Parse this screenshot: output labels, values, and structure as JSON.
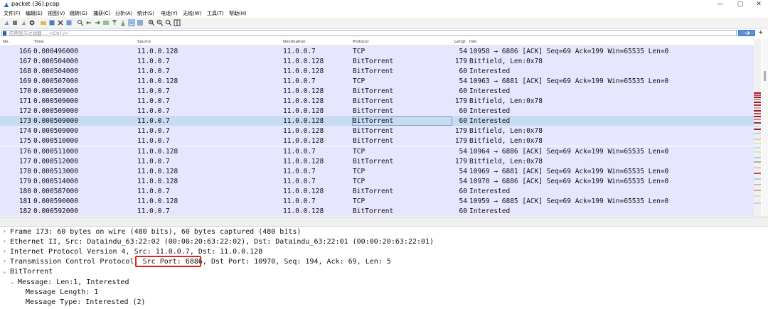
{
  "window": {
    "title": "packet (36).pcap",
    "controls": [
      "—",
      "▢",
      "✕"
    ]
  },
  "menu": [
    "文件(F)",
    "编辑(E)",
    "视图(V)",
    "跳转(G)",
    "捕获(C)",
    "分析(A)",
    "统计(S)",
    "电话(Y)",
    "无线(W)",
    "工具(T)",
    "帮助(H)"
  ],
  "filter": {
    "placeholder": "应用显示过滤器 … <Ctrl-/>"
  },
  "columns": [
    "No.",
    "Time",
    "Source",
    "Destination",
    "Protocol",
    "Lengt",
    "Info"
  ],
  "packets": [
    {
      "no": "166",
      "time": "0.000496000",
      "src": "11.0.0.128",
      "dst": "11.0.0.7",
      "proto": "TCP",
      "len": "54",
      "info": "10958 → 6886 [ACK] Seq=69 Ack=199 Win=65535 Len=0"
    },
    {
      "no": "167",
      "time": "0.000504000",
      "src": "11.0.0.7",
      "dst": "11.0.0.128",
      "proto": "BitTorrent",
      "len": "179",
      "info": "Bitfield, Len:0x78"
    },
    {
      "no": "168",
      "time": "0.000504000",
      "src": "11.0.0.7",
      "dst": "11.0.0.128",
      "proto": "BitTorrent",
      "len": "60",
      "info": "Interested"
    },
    {
      "no": "169",
      "time": "0.000507000",
      "src": "11.0.0.128",
      "dst": "11.0.0.7",
      "proto": "TCP",
      "len": "54",
      "info": "10963 → 6881 [ACK] Seq=69 Ack=199 Win=65535 Len=0"
    },
    {
      "no": "170",
      "time": "0.000509000",
      "src": "11.0.0.7",
      "dst": "11.0.0.128",
      "proto": "BitTorrent",
      "len": "60",
      "info": "Interested"
    },
    {
      "no": "171",
      "time": "0.000509000",
      "src": "11.0.0.7",
      "dst": "11.0.0.128",
      "proto": "BitTorrent",
      "len": "179",
      "info": "Bitfield, Len:0x78"
    },
    {
      "no": "172",
      "time": "0.000509000",
      "src": "11.0.0.7",
      "dst": "11.0.0.128",
      "proto": "BitTorrent",
      "len": "60",
      "info": "Interested"
    },
    {
      "no": "173",
      "time": "0.000509000",
      "src": "11.0.0.7",
      "dst": "11.0.0.128",
      "proto": "BitTorrent",
      "len": "60",
      "info": "Interested"
    },
    {
      "no": "174",
      "time": "0.000509000",
      "src": "11.0.0.7",
      "dst": "11.0.0.128",
      "proto": "BitTorrent",
      "len": "179",
      "info": "Bitfield, Len:0x78"
    },
    {
      "no": "175",
      "time": "0.000510000",
      "src": "11.0.0.7",
      "dst": "11.0.0.128",
      "proto": "BitTorrent",
      "len": "179",
      "info": "Bitfield, Len:0x78"
    },
    {
      "no": "176",
      "time": "0.000511000",
      "src": "11.0.0.128",
      "dst": "11.0.0.7",
      "proto": "TCP",
      "len": "54",
      "info": "10964 → 6886 [ACK] Seq=69 Ack=199 Win=65535 Len=0"
    },
    {
      "no": "177",
      "time": "0.000512000",
      "src": "11.0.0.7",
      "dst": "11.0.0.128",
      "proto": "BitTorrent",
      "len": "179",
      "info": "Bitfield, Len:0x78"
    },
    {
      "no": "178",
      "time": "0.000513000",
      "src": "11.0.0.128",
      "dst": "11.0.0.7",
      "proto": "TCP",
      "len": "54",
      "info": "10969 → 6881 [ACK] Seq=69 Ack=199 Win=65535 Len=0"
    },
    {
      "no": "179",
      "time": "0.000514000",
      "src": "11.0.0.128",
      "dst": "11.0.0.7",
      "proto": "TCP",
      "len": "54",
      "info": "10970 → 6886 [ACK] Seq=69 Ack=199 Win=65535 Len=0"
    },
    {
      "no": "180",
      "time": "0.000587000",
      "src": "11.0.0.7",
      "dst": "11.0.0.128",
      "proto": "BitTorrent",
      "len": "60",
      "info": "Interested"
    },
    {
      "no": "181",
      "time": "0.000590000",
      "src": "11.0.0.128",
      "dst": "11.0.0.7",
      "proto": "TCP",
      "len": "54",
      "info": "10959 → 6885 [ACK] Seq=69 Ack=199 Win=65535 Len=0"
    },
    {
      "no": "182",
      "time": "0.000592000",
      "src": "11.0.0.7",
      "dst": "11.0.0.128",
      "proto": "BitTorrent",
      "len": "60",
      "info": "Interested"
    }
  ],
  "selected_packet": "173",
  "details": [
    {
      "arrow": "›",
      "indent": 0,
      "text": "Frame 173: 60 bytes on wire (480 bits), 60 bytes captured (480 bits)"
    },
    {
      "arrow": "›",
      "indent": 0,
      "text": "Ethernet II, Src: Dataindu_63:22:02 (00:00:20:63:22:02), Dst: Dataindu_63:22:01 (00:00:20:63:22:01)"
    },
    {
      "arrow": "›",
      "indent": 0,
      "text": "Internet Protocol Version 4, Src: 11.0.0.7, Dst: 11.0.0.128"
    },
    {
      "arrow": "›",
      "indent": 0,
      "text": "Transmission Control Protocol, Src Port: 6886, Dst Port: 10970, Seq: 194, Ack: 69, Len: 5"
    },
    {
      "arrow": "⌄",
      "indent": 0,
      "text": "BitTorrent"
    },
    {
      "arrow": "⌄",
      "indent": 1,
      "text": "Message: Len:1, Interested"
    },
    {
      "arrow": "",
      "indent": 2,
      "text": "Message Length: 1"
    },
    {
      "arrow": "",
      "indent": 2,
      "text": "Message Type: Interested (2)"
    }
  ],
  "colors": {
    "row_bg": "#e7e6ff",
    "selected_bg": "#c7dcf2",
    "highlight_border": "#e0261b"
  }
}
